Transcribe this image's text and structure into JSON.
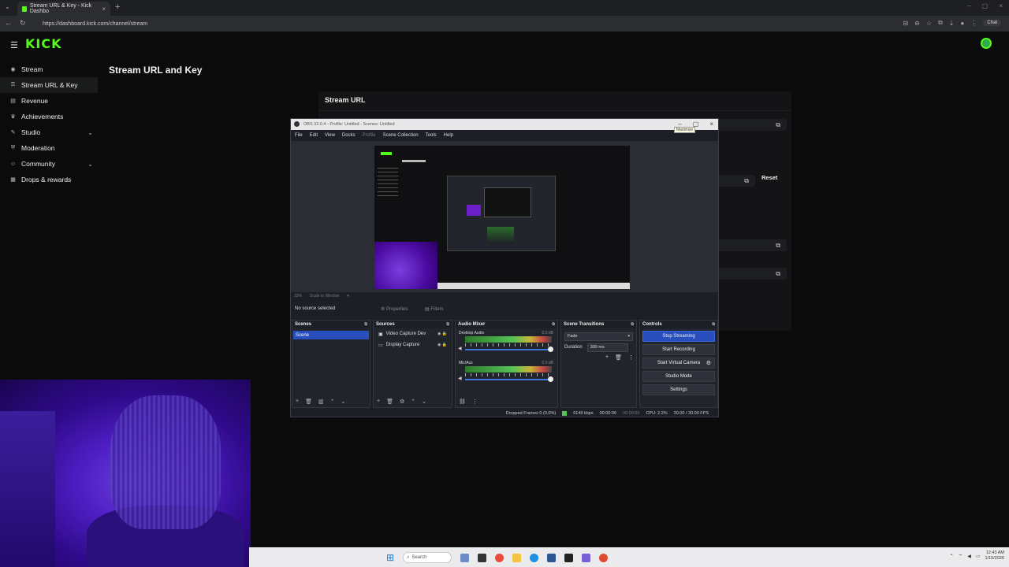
{
  "browser": {
    "tab_title": "Stream URL & Key - Kick Dashbo",
    "url": "https://dashboard.kick.com/channel/stream",
    "chat_label": "Chat"
  },
  "kick": {
    "logo": "KICK",
    "page_title": "Stream URL and Key",
    "sidebar": [
      {
        "label": "Stream",
        "icon": "stream-icon"
      },
      {
        "label": "Stream URL & Key",
        "icon": "key-icon",
        "active": true
      },
      {
        "label": "Revenue",
        "icon": "revenue-icon"
      },
      {
        "label": "Achievements",
        "icon": "trophy-icon"
      },
      {
        "label": "Studio",
        "icon": "studio-icon",
        "expandable": true
      },
      {
        "label": "Moderation",
        "icon": "shield-icon"
      },
      {
        "label": "Community",
        "icon": "people-icon",
        "expandable": true
      },
      {
        "label": "Drops & rewards",
        "icon": "gift-icon"
      }
    ],
    "card_title": "Stream URL",
    "reset_label": "Reset"
  },
  "obs": {
    "title": "OBS 32.0.4 - Profile: Untitled - Scenes: Untitled",
    "tooltip": "Maximize",
    "menu": [
      "File",
      "Edit",
      "View",
      "Docks",
      "Profile",
      "Scene Collection",
      "Tools",
      "Help"
    ],
    "preview_footer": [
      "33%",
      "Scale to Window"
    ],
    "no_source": "No source selected",
    "properties": "Properties",
    "filters": "Filters",
    "docks": {
      "scenes": {
        "title": "Scenes",
        "items": [
          "Scene"
        ]
      },
      "sources": {
        "title": "Sources",
        "items": [
          "Video Capture Dev",
          "Display Capture"
        ]
      },
      "mixer": {
        "title": "Audio Mixer",
        "channels": [
          {
            "name": "Desktop Audio",
            "db": "0.0 dB"
          },
          {
            "name": "Mic/Aux",
            "db": "0.0 dB"
          }
        ]
      },
      "transitions": {
        "title": "Scene Transitions",
        "type": "Fade",
        "duration_label": "Duration",
        "duration": "300 ms"
      },
      "controls": {
        "title": "Controls",
        "buttons": [
          "Stop Streaming",
          "Start Recording",
          "Start Virtual Camera",
          "Studio Mode",
          "Settings"
        ]
      }
    },
    "status": {
      "dropped": "Dropped Frames 0 (0.0%)",
      "bitrate": "6149 kbps",
      "stream_time": "00:00:06",
      "rec_time": "00:00:00",
      "cpu": "CPU: 2.2%",
      "fps": "30.00 / 30.00 FPS"
    }
  },
  "taskbar": {
    "search_label": "Search",
    "time": "12:43 AM",
    "date": "1/15/2026"
  }
}
